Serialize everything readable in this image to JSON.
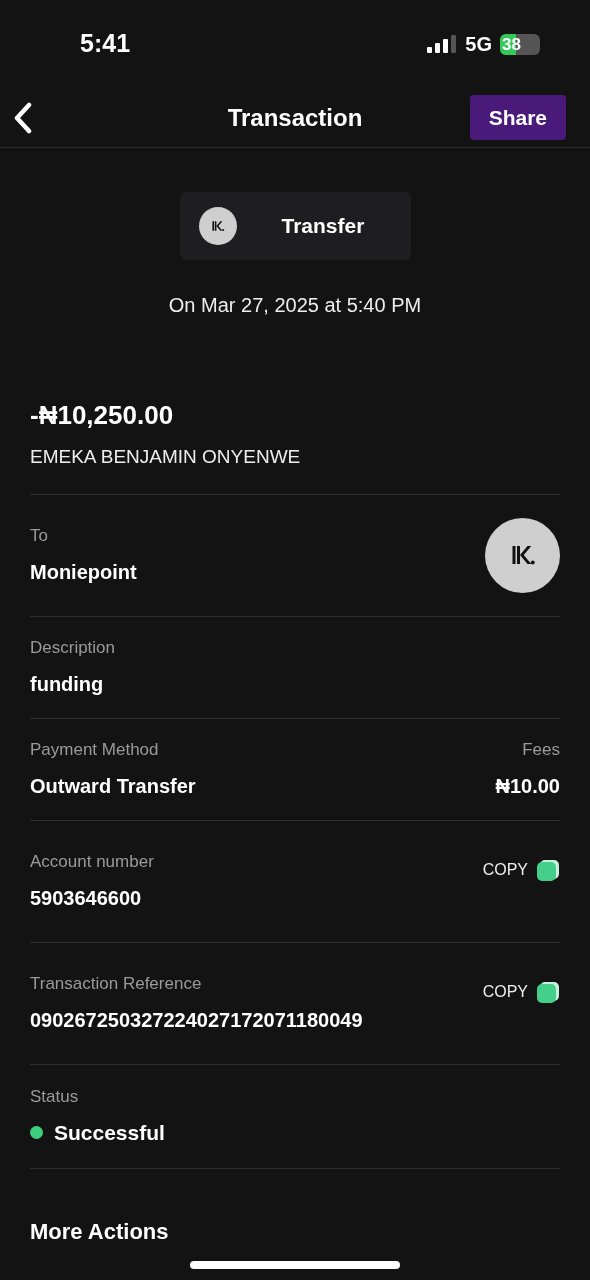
{
  "status_bar": {
    "time": "5:41",
    "network": "5G",
    "battery": "38"
  },
  "header": {
    "title": "Transaction",
    "share": "Share"
  },
  "type_chip": {
    "label": "Transfer"
  },
  "date": "On Mar 27, 2025 at 5:40 PM",
  "amount": "-₦10,250.00",
  "counterparty": "EMEKA BENJAMIN ONYENWE",
  "rows": [
    {
      "kind": "logo",
      "label": "To",
      "value": "Moniepoint"
    },
    {
      "kind": "plain",
      "label": "Description",
      "value": "funding"
    },
    {
      "kind": "split",
      "label": "Payment Method",
      "value": "Outward Transfer",
      "label_2": "Fees",
      "value_2": "₦10.00"
    },
    {
      "kind": "copy",
      "label": "Account number",
      "value": "5903646600",
      "action": "COPY"
    },
    {
      "kind": "copy",
      "label": "Transaction Reference",
      "value": "090267250327224027172071180049",
      "action": "COPY"
    },
    {
      "kind": "status",
      "label": "Status",
      "value": "Successful",
      "color": "#3ecf7e"
    }
  ],
  "more_actions": "More Actions"
}
